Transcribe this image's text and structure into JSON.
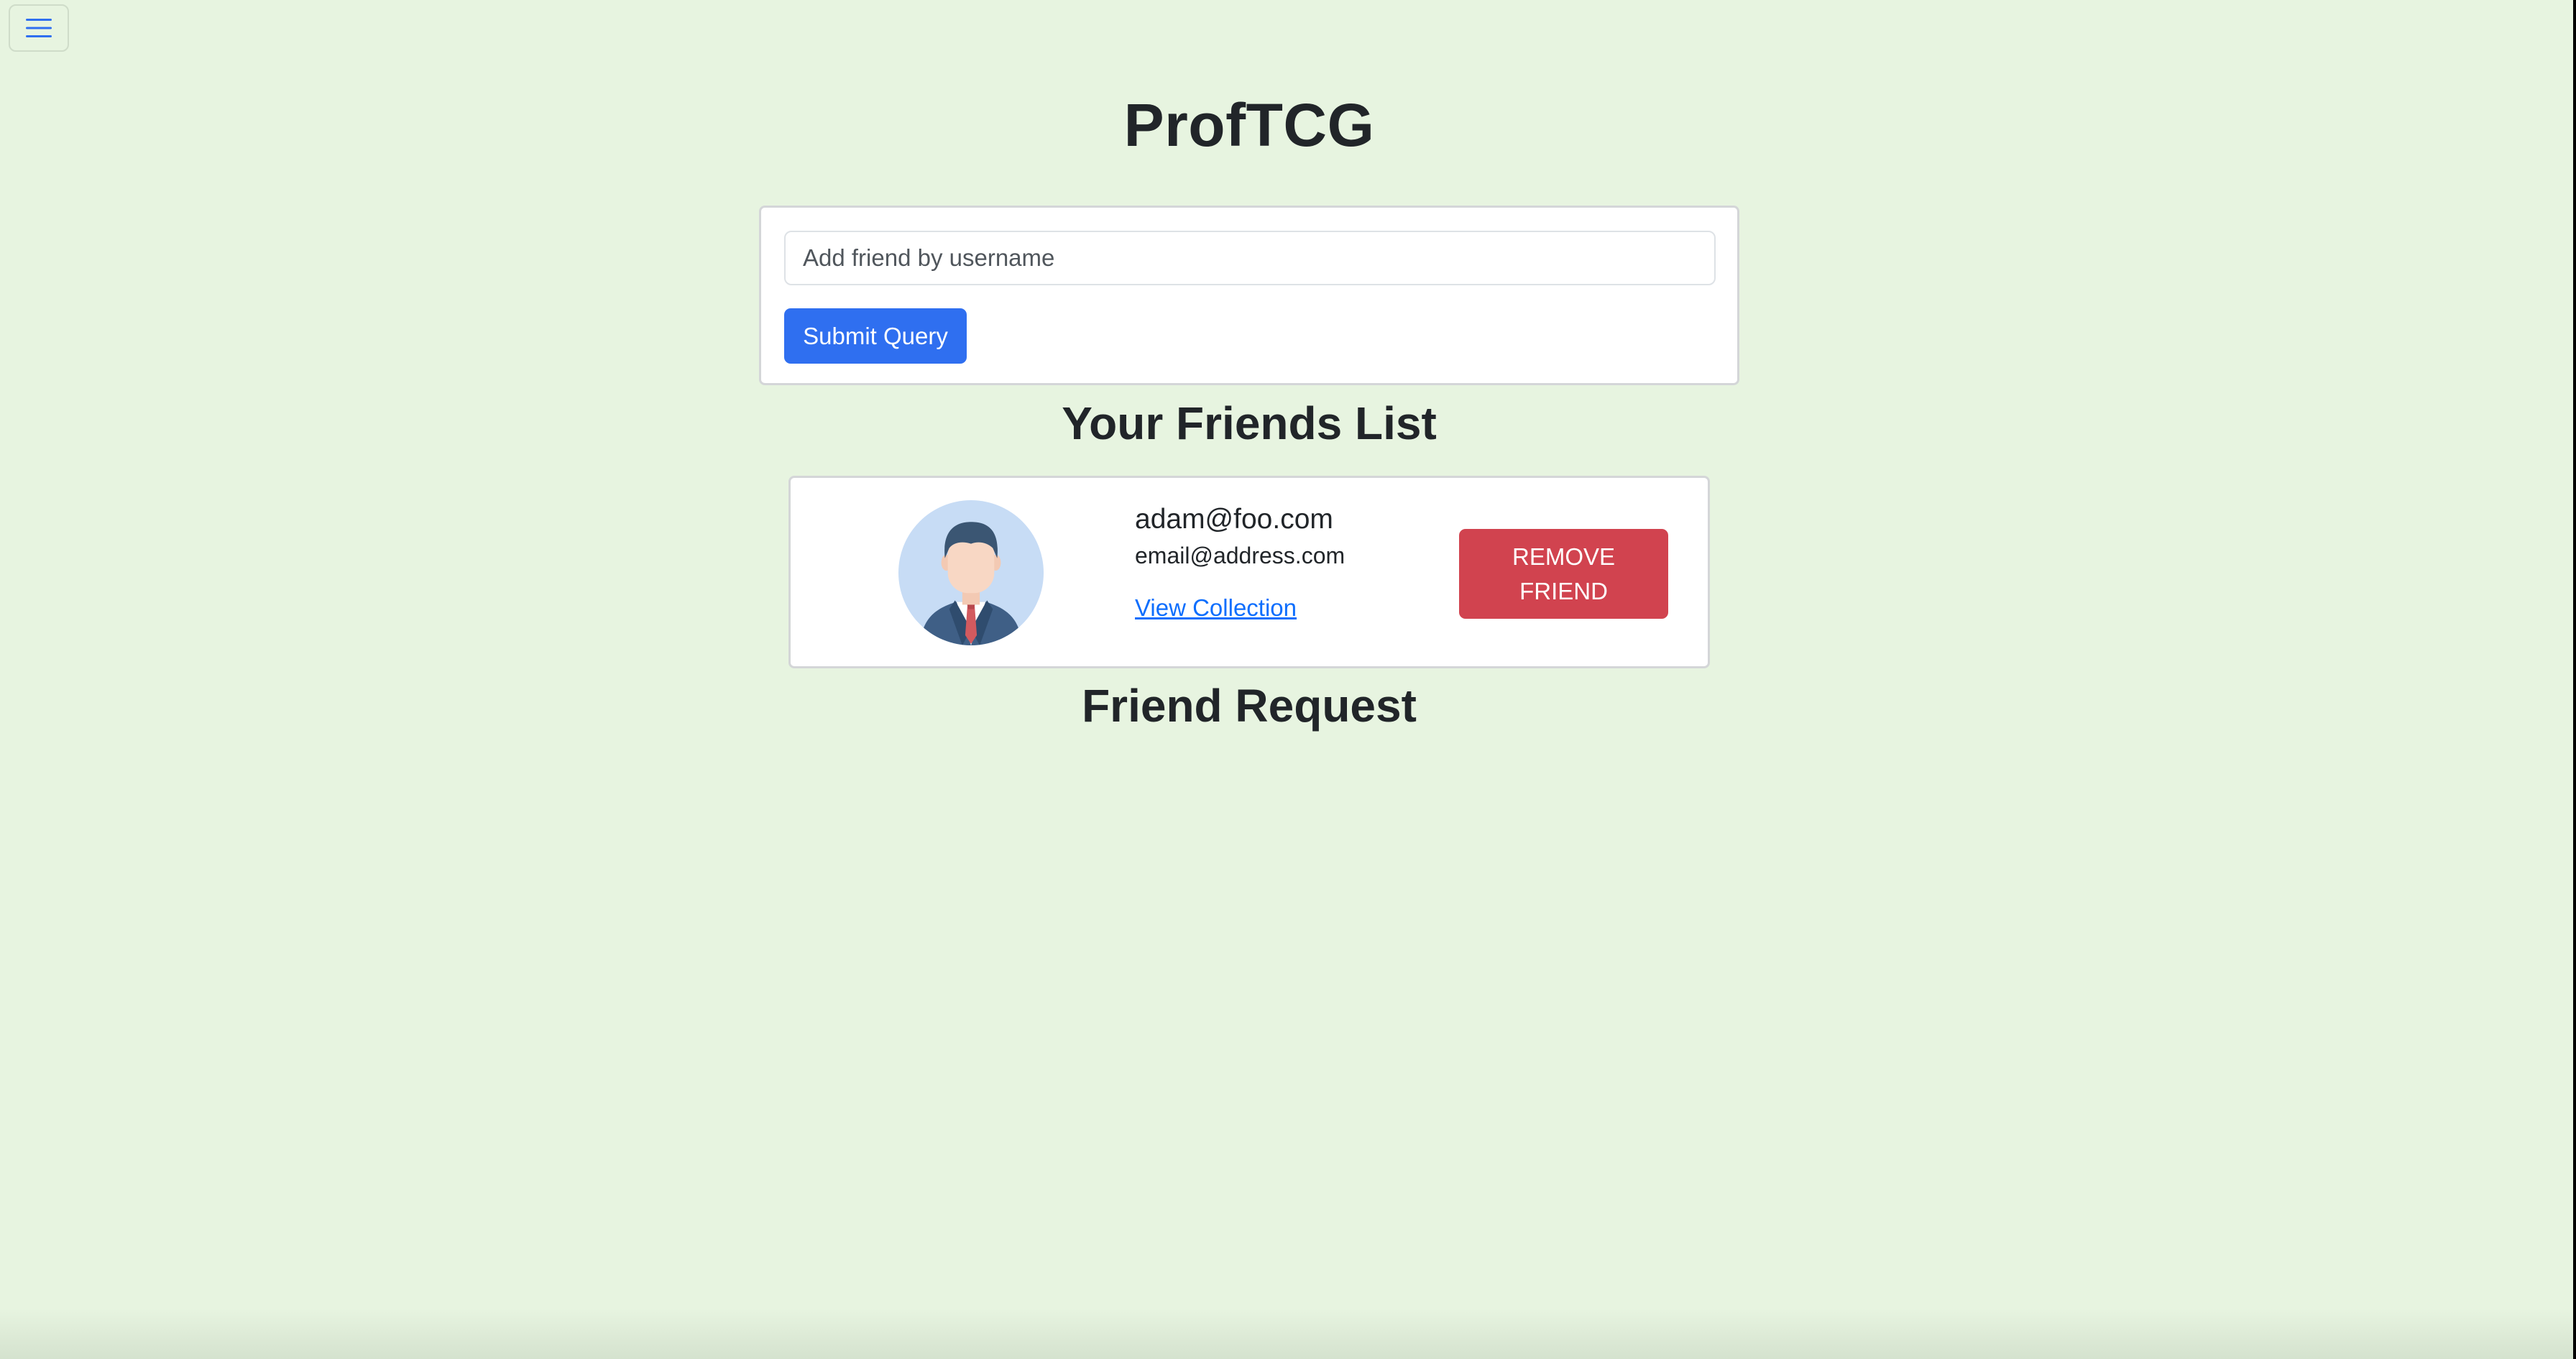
{
  "app": {
    "title": "ProfTCG",
    "menu_icon": "hamburger-menu-icon"
  },
  "add_friend": {
    "placeholder": "Add friend by username",
    "submit_label": "Submit Query"
  },
  "friends_section": {
    "heading": "Your Friends List",
    "friends": [
      {
        "username": "adam@foo.com",
        "email": "email@address.com",
        "link_label": "View Collection",
        "remove_label": "REMOVE FRIEND",
        "avatar_icon": "businessman-avatar-icon"
      }
    ]
  },
  "requests_section": {
    "heading": "Friend Request"
  },
  "colors": {
    "background": "#e7f4e0",
    "primary": "#2f6ff0",
    "danger": "#d1434f",
    "link": "#0d6efd"
  }
}
